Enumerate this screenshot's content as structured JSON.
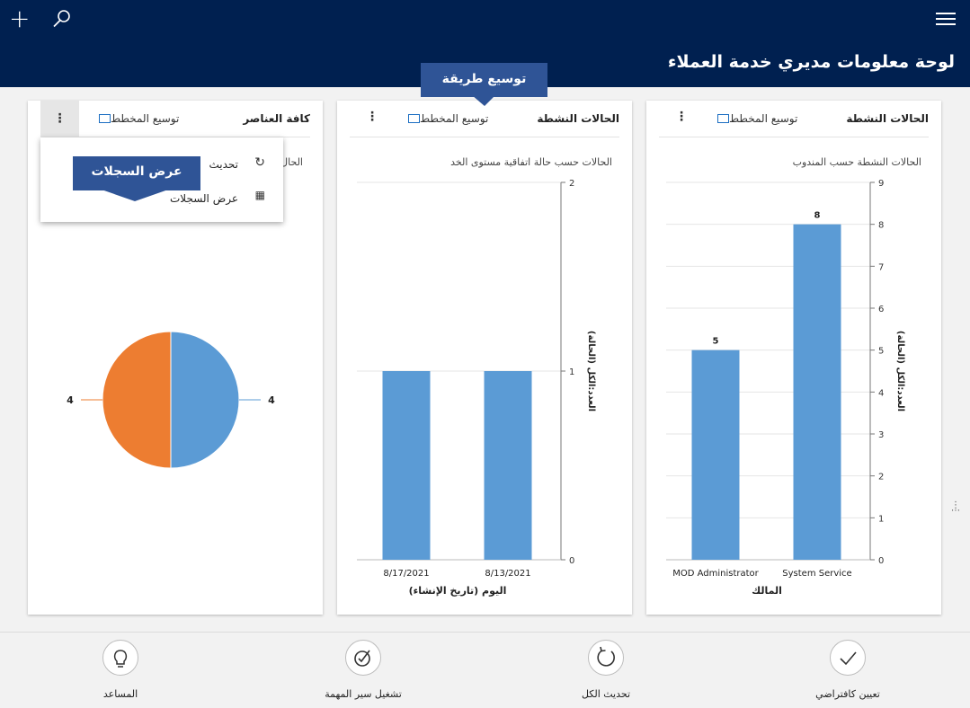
{
  "header": {
    "title": "لوحة معلومات مديري خدمة العملاء"
  },
  "cards": {
    "owner": {
      "title": "الحالات النشطة",
      "expand": "توسيع المخطط",
      "subtitle": "الحالات النشطة حسب المندوب"
    },
    "sla": {
      "title": "الحالات النشطة",
      "expand": "توسيع المخطط",
      "subtitle": "الحالات حسب حالة اتفاقية مستوى الخد"
    },
    "all": {
      "title": "كافة العناصر",
      "expand": "توسيع المخطط",
      "subtitle_fragment": "الحال"
    }
  },
  "dropdown": {
    "refresh": "تحديث",
    "view_records": "عرض السجلات"
  },
  "callouts": {
    "expand_view": "توسيع طريقة العرض",
    "view_records": "عرض السجلات"
  },
  "chart_data": [
    {
      "type": "bar",
      "categories": [
        "MOD Administrator",
        "System Service"
      ],
      "values": [
        5,
        8
      ],
      "xlabel": "المالك",
      "ylabel": "(العدد:الكل (الحالة",
      "ylim": [
        0,
        9
      ],
      "yticks": [
        0,
        1,
        2,
        3,
        4,
        5,
        6,
        7,
        8,
        9
      ],
      "data_labels": [
        "5",
        "8"
      ],
      "color": "#5b9bd5"
    },
    {
      "type": "bar",
      "categories": [
        "8/17/2021",
        "8/13/2021"
      ],
      "values": [
        1,
        1
      ],
      "xlabel": "اليوم (تاريخ الإنشاء)",
      "ylabel": "(العدد:الكل (الحالة",
      "ylim": [
        0,
        2
      ],
      "yticks": [
        0,
        1,
        2
      ],
      "color": "#5b9bd5"
    },
    {
      "type": "pie",
      "values": [
        4,
        4
      ],
      "labels": [
        "4",
        "4"
      ],
      "colors": [
        "#5b9bd5",
        "#ed7d31"
      ]
    }
  ],
  "bottombar": {
    "set_default": "تعيين كافتراضي",
    "refresh_all": "تحديث الكل",
    "run_flow": "تشغيل سير المهمة",
    "assistant": "المساعد"
  },
  "icons": {
    "add": "plus-icon",
    "search": "search-icon",
    "menu": "hamburger-icon"
  }
}
